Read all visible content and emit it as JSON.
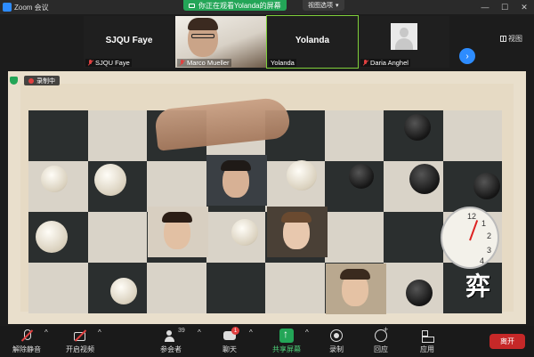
{
  "window": {
    "title": "Zoom 会议",
    "share_banner": "你正在观看Yolanda的屏幕",
    "view_options": "视图选项"
  },
  "thumbnails": [
    {
      "big_name": "SJQU Faye",
      "label": "SJQU Faye",
      "muted": true
    },
    {
      "big_name": "",
      "label": "Marco Mueller",
      "muted": true
    },
    {
      "big_name": "Yolanda",
      "label": "Yolanda",
      "muted": false
    },
    {
      "big_name": "",
      "label": "Daria Anghel",
      "muted": true
    }
  ],
  "view_button": "视图",
  "shared_screen": {
    "recording_label": "录制中",
    "logo_text": "弈",
    "clock_numbers": [
      "12",
      "1",
      "2",
      "3",
      "4"
    ]
  },
  "toolbar": {
    "unmute": "解除静音",
    "start_video": "开启视频",
    "participants": "参会者",
    "participants_count": "39",
    "chat": "聊天",
    "chat_badge": "1",
    "share": "共享屏幕",
    "record": "录制",
    "reactions": "回应",
    "apps": "应用",
    "leave": "离开"
  },
  "colors": {
    "accent_green": "#23a557",
    "zoom_blue": "#2d8cff",
    "leave_red": "#c62828",
    "muted_red": "#e04040"
  }
}
